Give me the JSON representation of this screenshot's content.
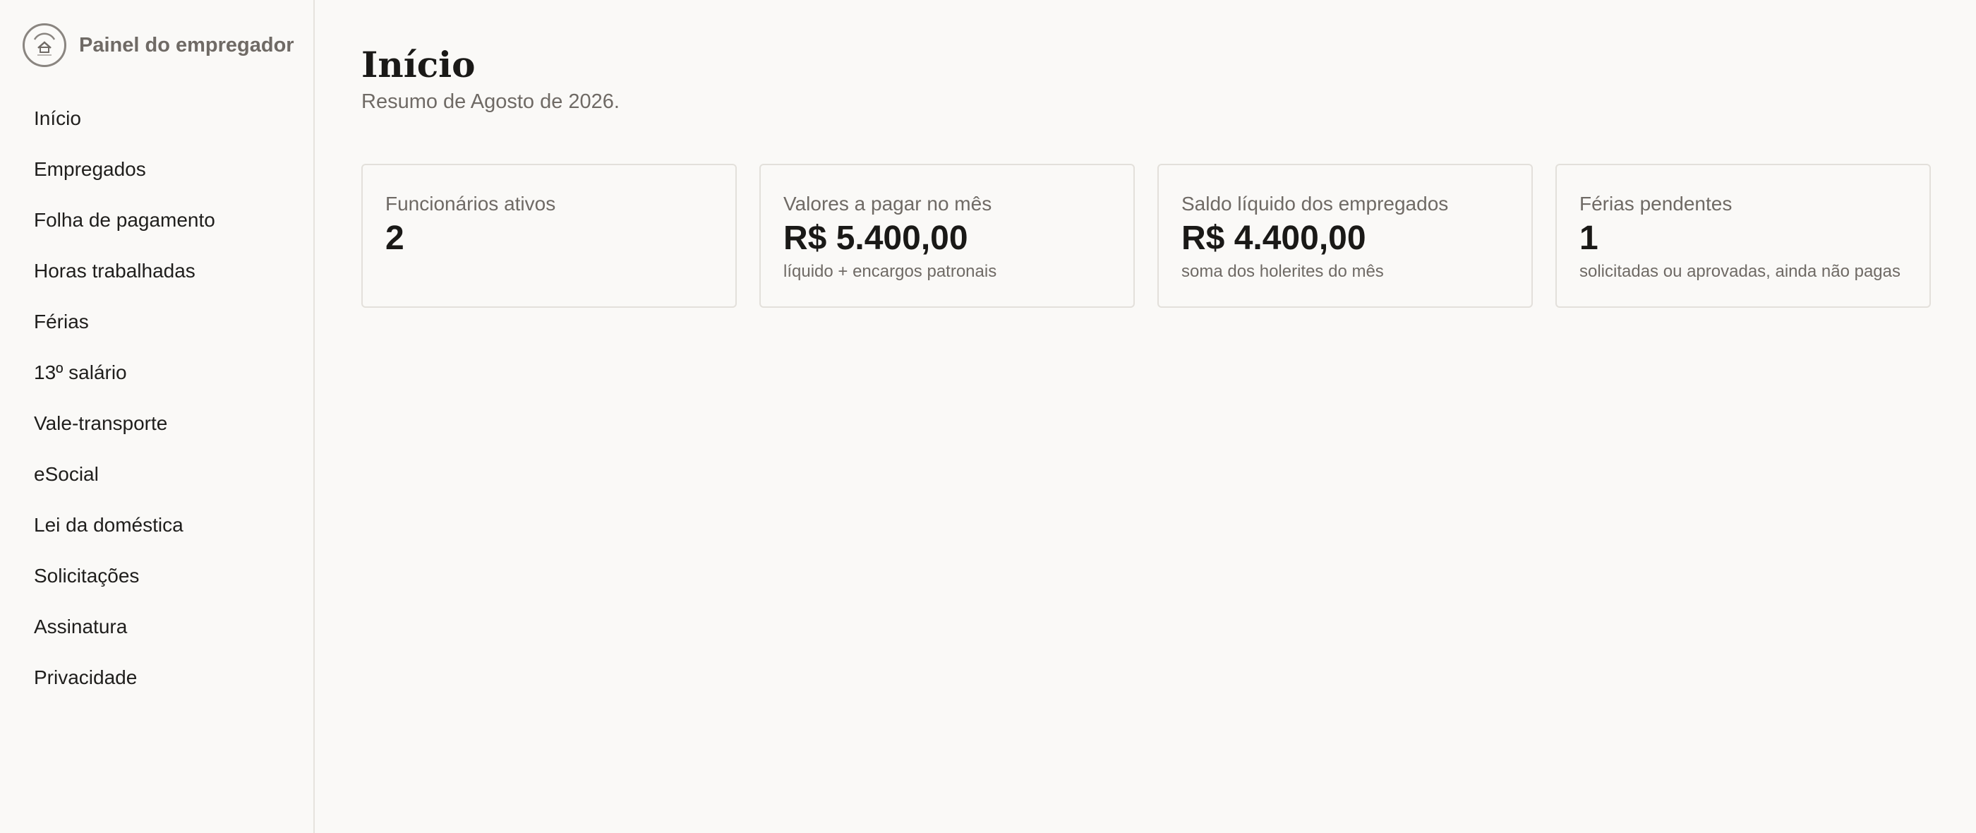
{
  "sidebar": {
    "brand_title": "Painel do empregador",
    "logo_icon": "house-logo-icon",
    "items": [
      {
        "label": "Início"
      },
      {
        "label": "Empregados"
      },
      {
        "label": "Folha de pagamento"
      },
      {
        "label": "Horas trabalhadas"
      },
      {
        "label": "Férias"
      },
      {
        "label": "13º salário"
      },
      {
        "label": "Vale-transporte"
      },
      {
        "label": "eSocial"
      },
      {
        "label": "Lei da doméstica"
      },
      {
        "label": "Solicitações"
      },
      {
        "label": "Assinatura"
      },
      {
        "label": "Privacidade"
      }
    ]
  },
  "main": {
    "title": "Início",
    "subtitle": "Resumo de Agosto de 2026.",
    "cards": [
      {
        "label": "Funcionários ativos",
        "value": "2",
        "note": ""
      },
      {
        "label": "Valores a pagar no mês",
        "value": "R$ 5.400,00",
        "note": "líquido + encargos patronais"
      },
      {
        "label": "Saldo líquido dos empregados",
        "value": "R$ 4.400,00",
        "note": "soma dos holerites do mês"
      },
      {
        "label": "Férias pendentes",
        "value": "1",
        "note": "solicitadas ou aprovadas, ainda não pagas"
      }
    ]
  },
  "colors": {
    "background": "#faf9f7",
    "border": "#e3e0db",
    "text_primary": "#1a1917",
    "text_muted": "#6f6a65"
  }
}
